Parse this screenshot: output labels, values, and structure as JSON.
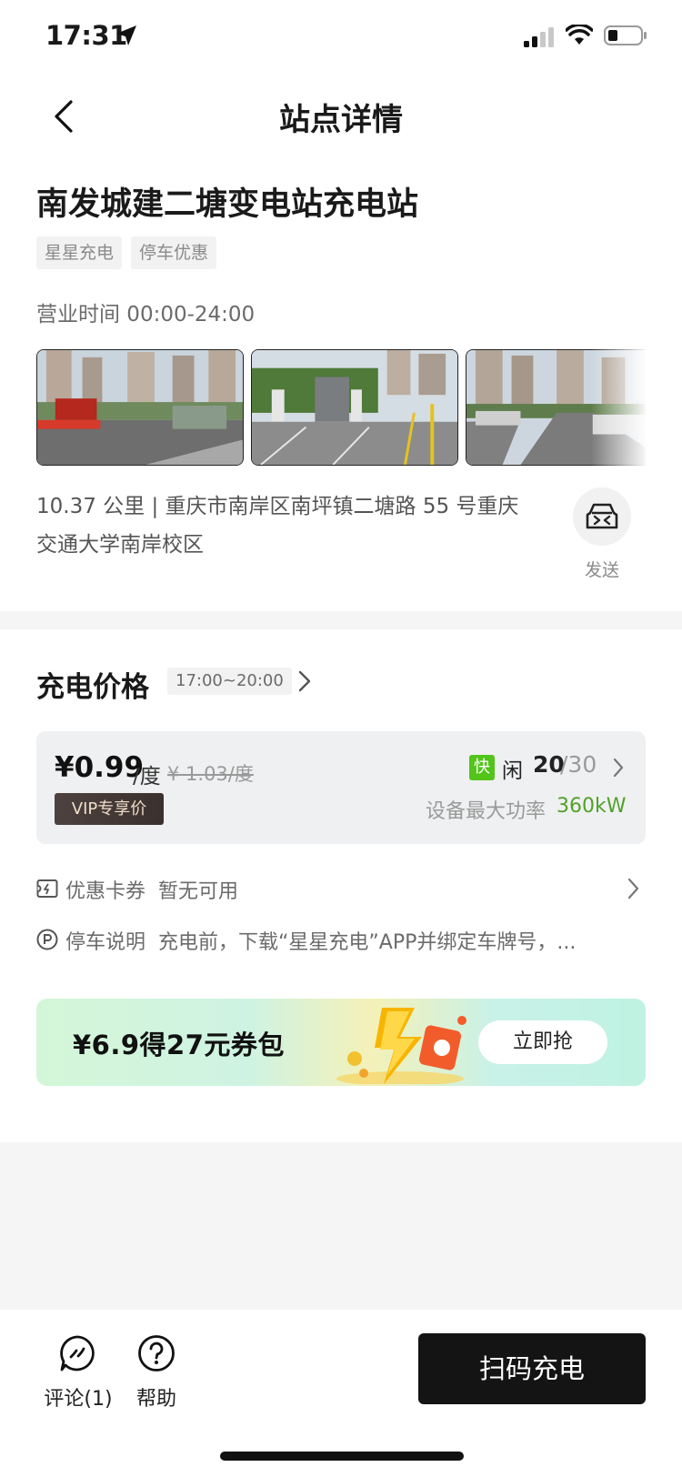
{
  "status_bar": {
    "time": "17:31",
    "icons": [
      "location-arrow-icon",
      "signal-icon",
      "wifi-icon",
      "battery-icon"
    ]
  },
  "nav": {
    "title": "站点详情",
    "back_icon": "chevron-left-icon"
  },
  "station": {
    "name": "南发城建二塘变电站充电站",
    "tags": [
      "星星充电",
      "停车优惠"
    ],
    "hours": "营业时间 00:00-24:00",
    "photos": [
      "station-entrance-photo",
      "charging-bays-photo",
      "parking-lot-photo"
    ],
    "address": "10.37 公里 | 重庆市南岸区南坪镇二塘路 55 号重庆交通大学南岸校区",
    "send_label": "发送",
    "send_icon": "car-icon"
  },
  "pricing": {
    "title": "充电价格",
    "time_range": "17:00~20:00",
    "current_price": "¥0.99",
    "unit": "/度",
    "original_price": "¥ 1.03/度",
    "vip_label": "VIP专享价",
    "fast_badge": "快",
    "idle_label": "闲",
    "idle_count": "20",
    "total_count": "/30",
    "power_label": "设备最大功率",
    "power_value": "360kW",
    "power_color": "#52a12a",
    "fast_color": "#52c41a"
  },
  "coupon": {
    "label": "优惠卡券",
    "status": "暂无可用",
    "icon": "coupon-card-icon"
  },
  "parking": {
    "label": "停车说明",
    "text": "充电前，下载“星星充电”APP并绑定车牌号，...",
    "icon": "parking-icon"
  },
  "promo": {
    "text": "¥6.9得27元券包",
    "button": "立即抢"
  },
  "bottom": {
    "comment_label": "评论(1)",
    "help_label": "帮助",
    "scan_button": "扫码充电"
  }
}
